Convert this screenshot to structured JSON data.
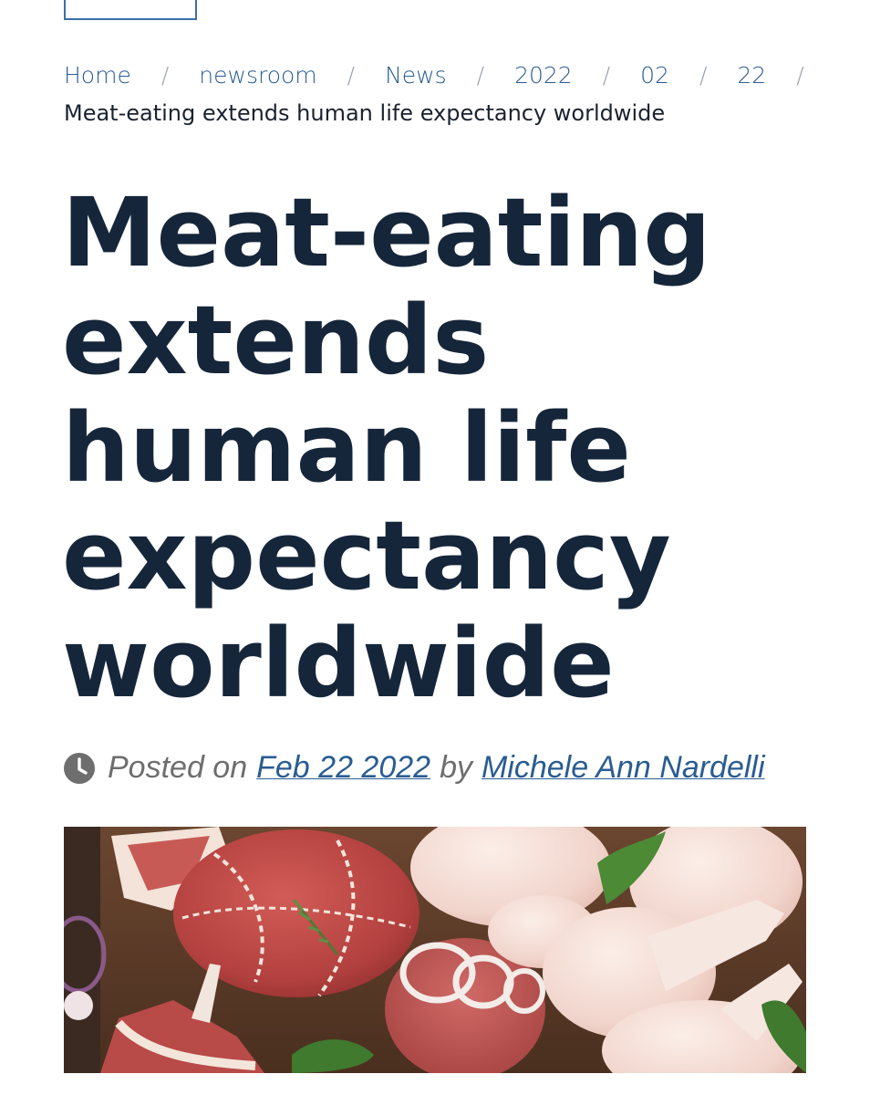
{
  "breadcrumb": {
    "items": [
      {
        "label": "Home"
      },
      {
        "label": "newsroom"
      },
      {
        "label": "News"
      },
      {
        "label": "2022"
      },
      {
        "label": "02"
      },
      {
        "label": "22"
      }
    ],
    "separator": "/",
    "current": "Meat-eating extends human life expectancy worldwide"
  },
  "article": {
    "title": "Meat-eating extends human life expectancy worldwide",
    "posted_on_label": "Posted on",
    "date": "Feb 22 2022",
    "by_label": "by",
    "author": "Michele Ann Nardelli"
  },
  "icons": {
    "meta": "clock-icon"
  },
  "colors": {
    "link": "#2a5c92",
    "title": "#16263a",
    "meta_text": "#6e6e6e"
  }
}
